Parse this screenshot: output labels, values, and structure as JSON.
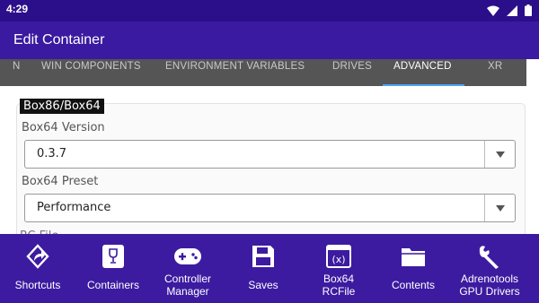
{
  "status_bar": {
    "time": "4:29"
  },
  "app_bar": {
    "title": "Edit Container"
  },
  "tabs": [
    {
      "label": "N"
    },
    {
      "label": "WIN COMPONENTS"
    },
    {
      "label": "ENVIRONMENT VARIABLES"
    },
    {
      "label": "DRIVES"
    },
    {
      "label": "ADVANCED"
    },
    {
      "label": "XR"
    }
  ],
  "section": {
    "title": "Box86/Box64",
    "fields": [
      {
        "label": "Box64 Version",
        "value": "0.3.7"
      },
      {
        "label": "Box64 Preset",
        "value": "Performance"
      }
    ],
    "next_label_partial": "RC File"
  },
  "bottom_nav": [
    {
      "label_1": "Shortcuts",
      "label_2": "",
      "icon": "shortcuts-icon"
    },
    {
      "label_1": "Containers",
      "label_2": "",
      "icon": "wine-glass-icon"
    },
    {
      "label_1": "Controller",
      "label_2": "Manager",
      "icon": "gamepad-icon"
    },
    {
      "label_1": "Saves",
      "label_2": "",
      "icon": "floppy-disk-icon"
    },
    {
      "label_1": "Box64",
      "label_2": "RCFile",
      "icon": "variable-icon"
    },
    {
      "label_1": "Contents",
      "label_2": "",
      "icon": "folder-icon"
    },
    {
      "label_1": "Adrenotools",
      "label_2": "GPU Drivers",
      "icon": "wrench-icon"
    }
  ],
  "colors": {
    "status_bar": "#2b0f8a",
    "app_bar": "#3a1aa0",
    "bottom_nav": "#3c1ba0",
    "tab_indicator": "#4aa3f5"
  }
}
